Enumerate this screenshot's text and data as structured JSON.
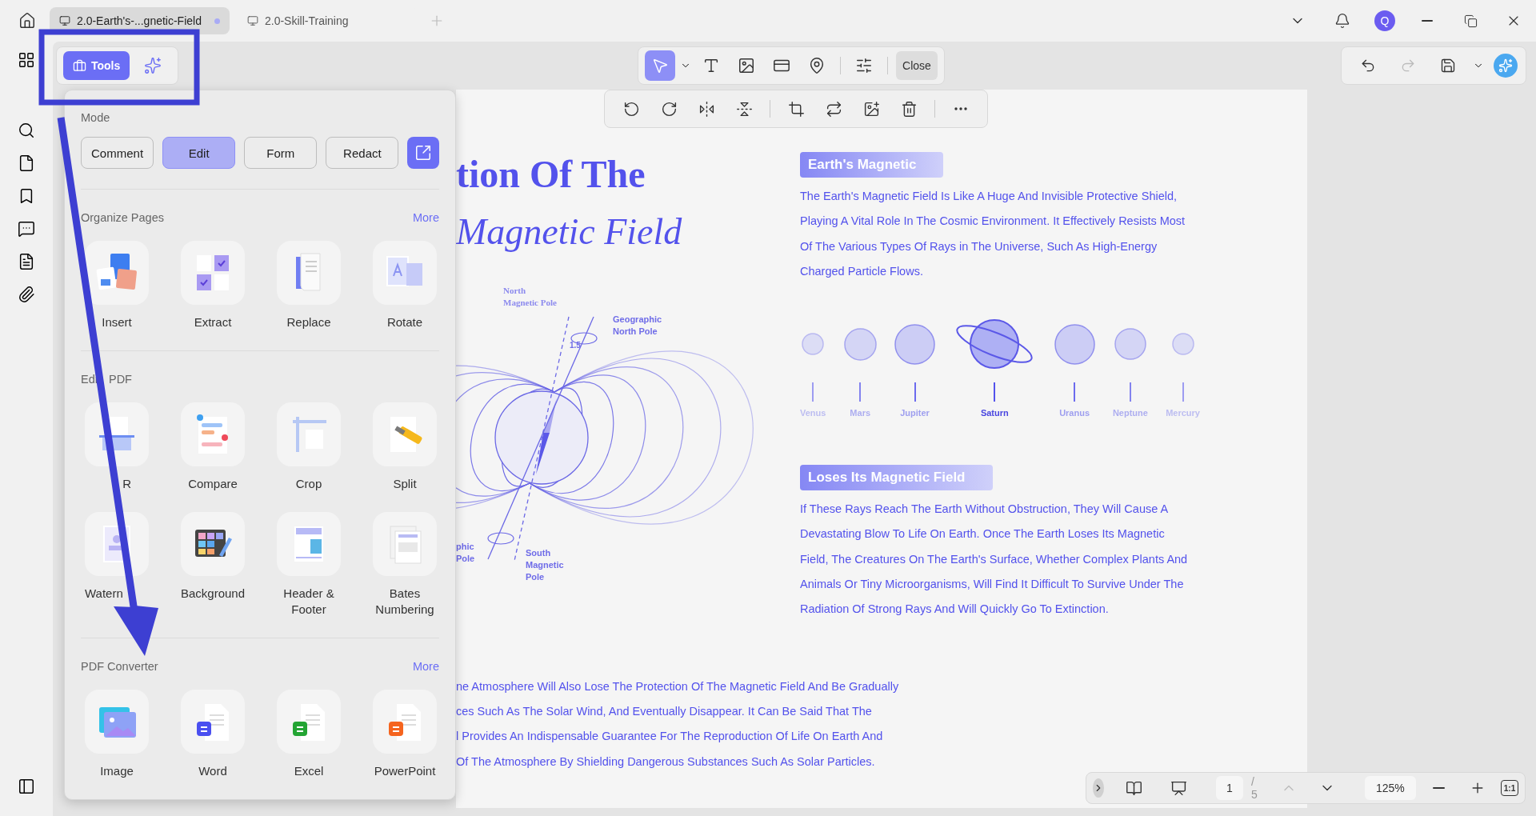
{
  "tabs": [
    {
      "label": "2.0-Earth's-...gnetic-Field",
      "selected": true,
      "unsaved": true
    },
    {
      "label": "2.0-Skill-Training",
      "selected": false,
      "unsaved": false
    }
  ],
  "user": {
    "initial": "Q"
  },
  "tools_switch": [
    {
      "kind": "tools",
      "label": "Tools",
      "selected": true
    },
    {
      "kind": "ai",
      "selected": false
    }
  ],
  "edit_tools": [
    {
      "kind": "select",
      "selected": true
    },
    {
      "kind": "text",
      "selected": false
    },
    {
      "kind": "image",
      "selected": false
    },
    {
      "kind": "link",
      "selected": false
    },
    {
      "kind": "stamp",
      "selected": false
    }
  ],
  "close_button": "Close",
  "history": {
    "undo_disabled": false,
    "redo_disabled": true
  },
  "tools_panel": {
    "mode_label": "Mode",
    "modes": [
      {
        "label": "Comment",
        "selected": false
      },
      {
        "label": "Edit",
        "selected": true
      },
      {
        "label": "Form",
        "selected": false
      },
      {
        "label": "Redact",
        "selected": false
      }
    ],
    "sections": [
      {
        "title": "Organize Pages",
        "more": "More",
        "items": [
          {
            "kind": "insert",
            "label": "Insert"
          },
          {
            "kind": "extract",
            "label": "Extract"
          },
          {
            "kind": "replace",
            "label": "Replace"
          },
          {
            "kind": "rotate",
            "label": "Rotate"
          }
        ]
      },
      {
        "title": [
          "Edi",
          "PDF"
        ],
        "items": [
          {
            "kind": "ocr",
            "label": "R",
            "cut_before": true
          },
          {
            "kind": "compare",
            "label": "Compare"
          },
          {
            "kind": "crop",
            "label": "Crop"
          },
          {
            "kind": "split",
            "label": "Split"
          },
          {
            "kind": "watermark",
            "label": "Watern",
            "cut_after": true
          },
          {
            "kind": "background",
            "label": "Background"
          },
          {
            "kind": "header_footer",
            "label": "Header & Footer"
          },
          {
            "kind": "bates",
            "label": "Bates Numbering"
          }
        ]
      },
      {
        "title": "PDF Converter",
        "more": "More",
        "items": [
          {
            "kind": "image",
            "label": "Image"
          },
          {
            "kind": "word",
            "label": "Word"
          },
          {
            "kind": "excel",
            "label": "Excel"
          },
          {
            "kind": "powerpoint",
            "label": "PowerPoint"
          }
        ]
      }
    ]
  },
  "document": {
    "title_line1": "tion Of The",
    "title_line2": "Magnetic Field",
    "diagram_labels": {
      "north_magnetic": [
        "North",
        "Magnetic Pole"
      ],
      "geographic_north": [
        "Geographic",
        "North Pole"
      ],
      "angle": "1.5",
      "geographic_south": [
        "phic",
        "Pole"
      ],
      "south_magnetic": [
        "South",
        "Magnetic",
        "Pole"
      ]
    },
    "sections": [
      {
        "heading": "Earth's Magnetic",
        "text": "The Earth's Magnetic Field Is Like A Huge And Invisible Protective Shield, Playing A Vital Role In The Cosmic Environment. It Effectively Resists Most Of The Various Types Of Rays in The Universe, Such As High-Energy Charged Particle Flows."
      },
      {
        "heading": "Loses Its Magnetic Field",
        "text": "If These Rays Reach The Earth Without Obstruction, They Will Cause A Devastating Blow To Life On Earth. Once The Earth Loses Its Magnetic Field, The Creatures On The Earth's Surface, Whether Complex Plants And Animals Or Tiny Microorganisms, Will Find It Difficult To Survive Under The Radiation Of Strong Rays And Will Quickly Go To Extinction."
      }
    ],
    "planets": [
      {
        "name": "Venus",
        "selected": false
      },
      {
        "name": "Mars",
        "selected": false
      },
      {
        "name": "Jupiter",
        "selected": false
      },
      {
        "name": "Saturn",
        "selected": true
      },
      {
        "name": "Uranus",
        "selected": false
      },
      {
        "name": "Neptune",
        "selected": false
      },
      {
        "name": "Mercury",
        "selected": false
      }
    ],
    "footer_lines": [
      "ne Atmosphere Will Also Lose The Protection Of The Magnetic Field And Be Gradually",
      "ces Such As The Solar Wind, And Eventually Disappear. It Can Be Said That The",
      "l Provides An Indispensable Guarantee For The Reproduction Of Life On Earth And",
      "Of The Atmosphere By Shielding Dangerous Substances Such As Solar Particles."
    ]
  },
  "page_nav": {
    "current": "1",
    "total": "/ 5",
    "prev_disabled": true,
    "zoom": "125%",
    "actual_size": "1:1"
  }
}
